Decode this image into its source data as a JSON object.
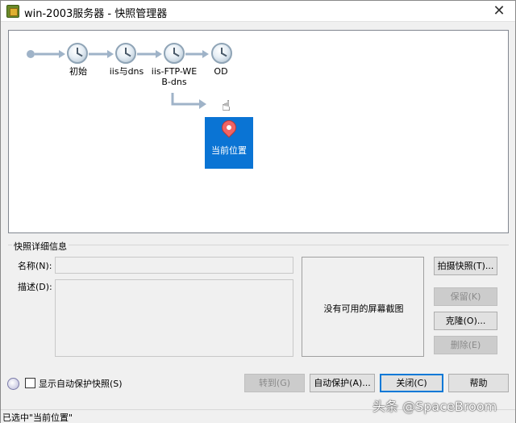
{
  "window": {
    "title": "win-2003服务器 - 快照管理器",
    "close_glyph": "✕"
  },
  "tree": {
    "nodes": [
      {
        "label": "初始"
      },
      {
        "label": "iis与dns"
      },
      {
        "label": "iis-FTP-WEB-dns"
      },
      {
        "label": "OD"
      }
    ],
    "node_label_lines": {
      "n3_line1": "iis-FTP-WE",
      "n3_line2": "B-dns"
    },
    "current": {
      "label": "当前位置",
      "icon": "map-pin-icon"
    },
    "colors": {
      "accent": "#0a74d4",
      "connector": "#9fb3c8"
    }
  },
  "details": {
    "group_title": "快照详细信息",
    "name_label": "名称(N):",
    "name_value": "",
    "desc_label": "描述(D):",
    "desc_value": "",
    "no_screenshot": "没有可用的屏幕截图"
  },
  "actions": {
    "take_snapshot": "拍摄快照(T)...",
    "keep": "保留(K)",
    "clone": "克隆(O)...",
    "delete": "删除(E)"
  },
  "footer": {
    "show_autoprotect": "显示自动保护快照(S)",
    "goto": "转到(G)",
    "autoprotect": "自动保护(A)...",
    "close": "关闭(C)",
    "help": "帮助"
  },
  "status": {
    "text": "已选中\"当前位置\""
  },
  "watermark": {
    "text": "头条 @SpaceBroom"
  }
}
